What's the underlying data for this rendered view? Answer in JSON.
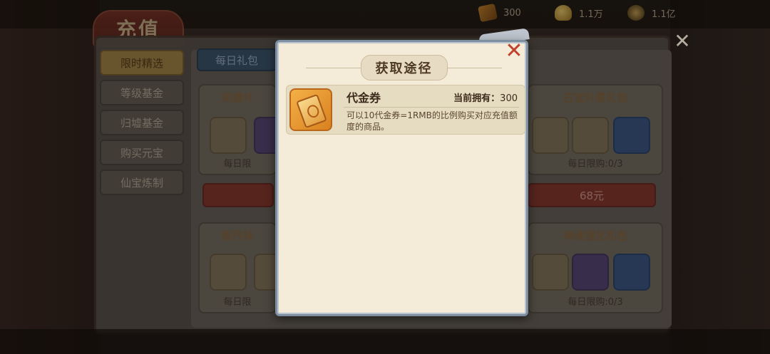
{
  "topbar": {
    "resources": [
      {
        "icon": "voucher-icon",
        "value": "300"
      },
      {
        "icon": "gold-ingot-icon",
        "value": "1.1万"
      },
      {
        "icon": "copper-coin-icon",
        "value": "1.1亿"
      }
    ]
  },
  "shop": {
    "title": "充值",
    "side_tabs": [
      {
        "label": "限时精选",
        "active": true
      },
      {
        "label": "等级基金",
        "active": false
      },
      {
        "label": "归墟基金",
        "active": false
      },
      {
        "label": "购买元宝",
        "active": false
      },
      {
        "label": "仙宝炼制",
        "active": false
      }
    ],
    "daily_tab": "每日礼包",
    "cards": [
      {
        "title": "英雄升",
        "limit": "每日限"
      },
      {
        "title": "古宝升星礼包",
        "limit": "每日限购:0/3",
        "price": "68元"
      },
      {
        "title": "炼丹林",
        "limit": "每日限"
      },
      {
        "title": "神魂强化礼包",
        "limit": "每日限购:0/3"
      }
    ]
  },
  "modal": {
    "title": "获取途径",
    "item": {
      "name": "代金券",
      "owned_label": "当前拥有：",
      "owned_value": "300",
      "description": "可以10代金券=1RMB的比例购买对应充值额度的商品。"
    }
  },
  "colors": {
    "modal_bg": "#f4ecd9",
    "close_red": "#c0412d",
    "tab_active": "#a8884a",
    "price_red": "#8b3a30"
  }
}
